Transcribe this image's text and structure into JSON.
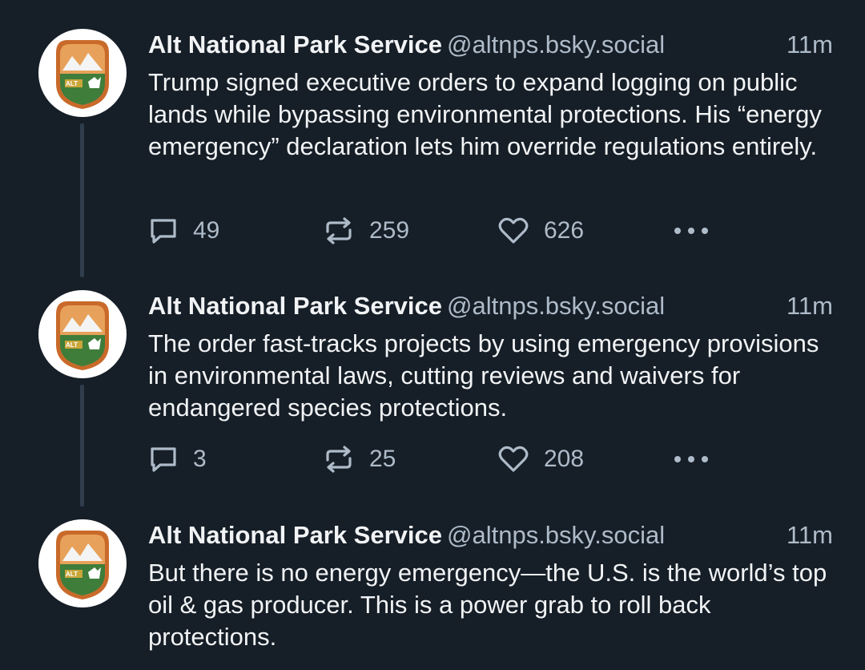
{
  "colors": {
    "background": "#161e27",
    "text_primary": "#f1f3f5",
    "text_secondary": "#aebbc9",
    "thread_line": "#2f3d4c"
  },
  "posts": [
    {
      "author_name": "Alt National Park Service",
      "handle": "@altnps.bsky.social",
      "time": "11m",
      "text": "Trump signed executive orders to expand logging on public lands while bypassing environmental protections. His “energy emergency” declaration lets him override regulations entirely.",
      "replies": "49",
      "reposts": "259",
      "likes": "626",
      "avatar_icon": "altus-national-park-service-logo"
    },
    {
      "author_name": "Alt National Park Service",
      "handle": "@altnps.bsky.social",
      "time": "11m",
      "text": "The order fast-tracks projects by using emergency provisions in environmental laws, cutting reviews and waivers for endangered species protections.",
      "replies": "3",
      "reposts": "25",
      "likes": "208",
      "avatar_icon": "altus-national-park-service-logo"
    },
    {
      "author_name": "Alt National Park Service",
      "handle": "@altnps.bsky.social",
      "time": "11m",
      "text": "But there is no energy emergency—the U.S. is the world’s top oil & gas producer. This is a power grab to roll back protections.",
      "avatar_icon": "altus-national-park-service-logo"
    }
  ],
  "icons": {
    "reply": "speech-bubble-icon",
    "repost": "repost-arrows-icon",
    "like": "heart-icon",
    "more": "ellipsis-icon"
  }
}
